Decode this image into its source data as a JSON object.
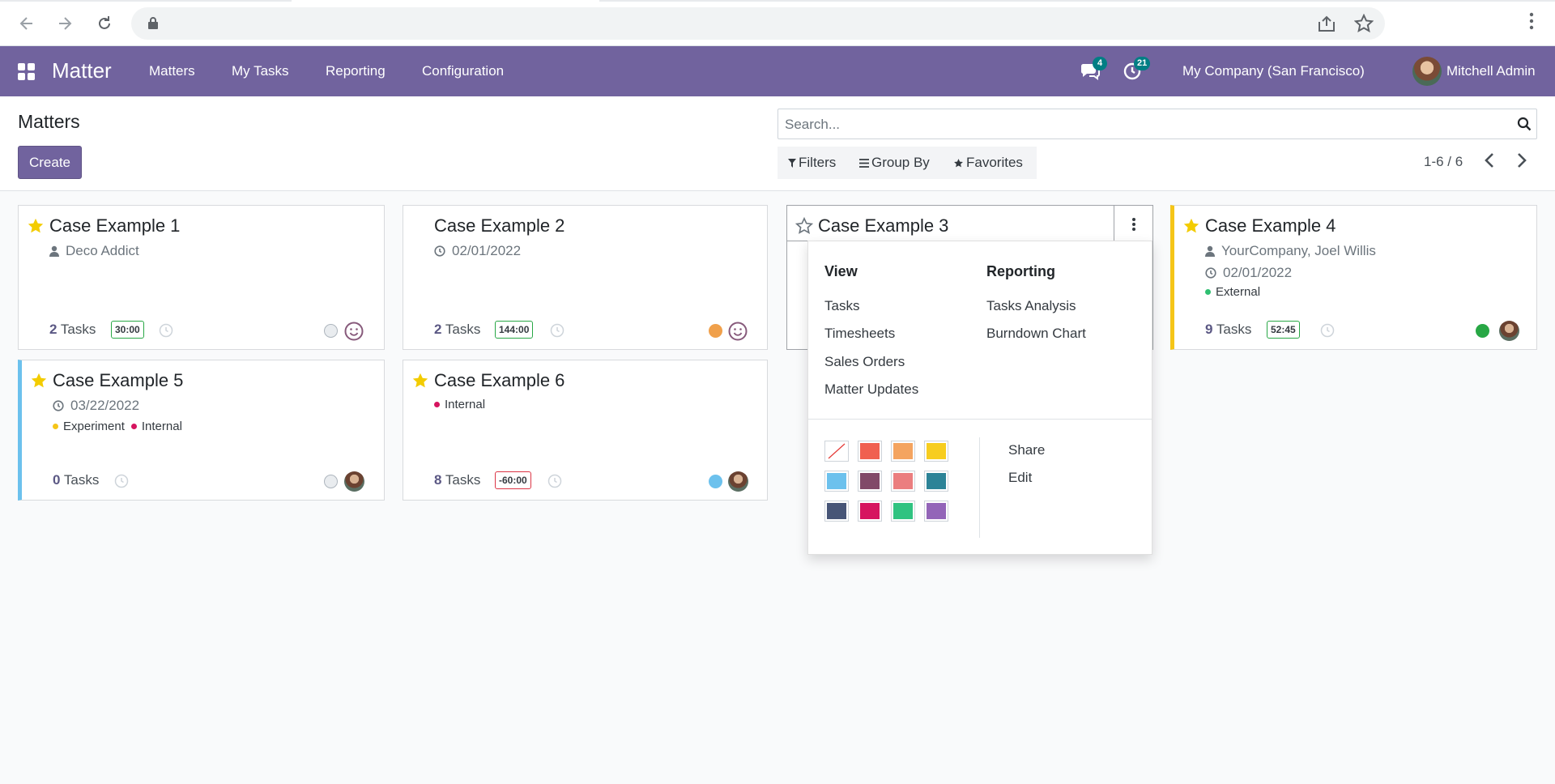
{
  "browser": {},
  "navbar": {
    "brand": "Matter",
    "menus": [
      "Matters",
      "My Tasks",
      "Reporting",
      "Configuration"
    ],
    "messages_count": "4",
    "activities_count": "21",
    "company": "My Company (San Francisco)",
    "user": "Mitchell Admin"
  },
  "control": {
    "title": "Matters",
    "create_label": "Create",
    "search_placeholder": "Search...",
    "filters_label": "Filters",
    "groupby_label": "Group By",
    "favorites_label": "Favorites",
    "pager": "1-6 / 6"
  },
  "cards": [
    {
      "name": "Case Example 1",
      "starred": true,
      "subtitle": "Deco Addict",
      "subtitle_icon": "user-icon",
      "task_count": "2",
      "tasks_label": "Tasks",
      "time": "30:00",
      "status_color": "#e9ecef",
      "assignee": "smiley-icon"
    },
    {
      "name": "Case Example 2",
      "starred": false,
      "subtitle": "02/01/2022",
      "subtitle_icon": "clock-icon",
      "task_count": "2",
      "tasks_label": "Tasks",
      "time": "144:00",
      "status_color": "#f0a04b",
      "assignee": "smiley-icon"
    },
    {
      "name": "Case Example 3",
      "starred": false
    },
    {
      "name": "Case Example 4",
      "starred": true,
      "subtitle": "YourCompany, Joel Willis",
      "subtitle_icon": "user-icon",
      "date": "02/01/2022",
      "tags": [
        "External"
      ],
      "tag_colors": [
        "#2fbf71"
      ],
      "task_count": "9",
      "tasks_label": "Tasks",
      "time": "52:45",
      "status_color": "#28a745",
      "assignee": "photo",
      "accent_color": "#f5c518"
    },
    {
      "name": "Case Example 5",
      "starred": true,
      "subtitle": "03/22/2022",
      "subtitle_icon": "clock-icon",
      "tags": [
        "Experiment",
        "Internal"
      ],
      "tag_colors": [
        "#f5c518",
        "#d6145f"
      ],
      "task_count": "0",
      "tasks_label": "Tasks",
      "status_color": "#e9ecef",
      "assignee": "photo",
      "accent_color": "#6cc1ed"
    },
    {
      "name": "Case Example 6",
      "starred": true,
      "tags": [
        "Internal"
      ],
      "tag_colors": [
        "#d6145f"
      ],
      "task_count": "8",
      "tasks_label": "Tasks",
      "time": "-60:00",
      "status_color": "#6cc1ed",
      "assignee": "photo"
    }
  ],
  "dropdown": {
    "view_title": "View",
    "view_items": [
      "Tasks",
      "Timesheets",
      "Sales Orders",
      "Matter Updates"
    ],
    "reporting_title": "Reporting",
    "reporting_items": [
      "Tasks Analysis",
      "Burndown Chart"
    ],
    "actions": [
      "Share",
      "Edit"
    ],
    "colors": [
      "none",
      "#f06050",
      "#f4a460",
      "#f7cd1f",
      "#6cc1ed",
      "#814968",
      "#eb7e7f",
      "#2c8397",
      "#475577",
      "#d6145f",
      "#30c381",
      "#9365b8"
    ]
  }
}
